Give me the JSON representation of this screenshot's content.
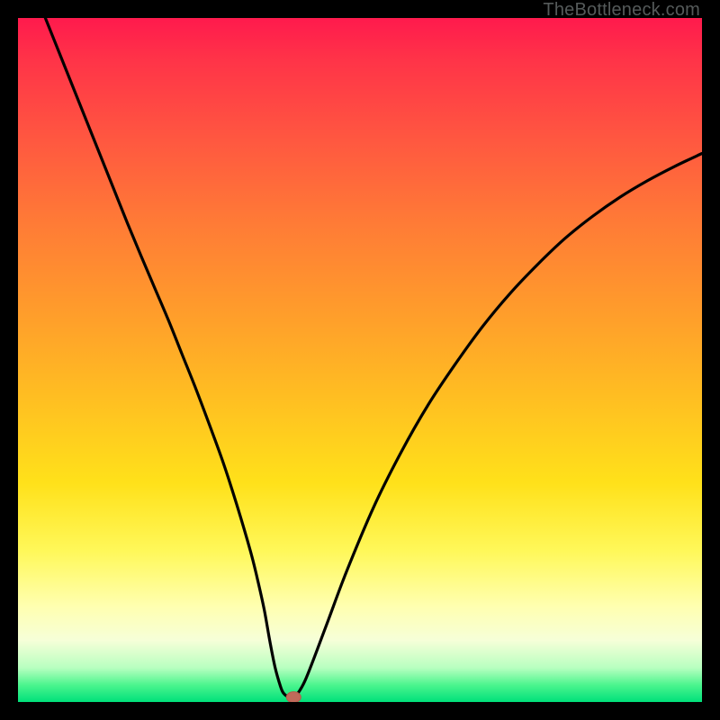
{
  "watermark": "TheBottleneck.com",
  "chart_data": {
    "type": "line",
    "title": "",
    "xlabel": "",
    "ylabel": "",
    "xlim": [
      0,
      100
    ],
    "ylim": [
      0,
      100
    ],
    "grid": false,
    "series": [
      {
        "name": "curve",
        "x": [
          4,
          6,
          8,
          10,
          12,
          14,
          16,
          18,
          20,
          22,
          24,
          26,
          28,
          30,
          32,
          34,
          35,
          36,
          36.8,
          37.6,
          38.4,
          38.8,
          39.4,
          40.2,
          40.4,
          42,
          45,
          48,
          52,
          56,
          60,
          64,
          68,
          72,
          76,
          80,
          84,
          88,
          92,
          96,
          100
        ],
        "y": [
          100,
          95,
          90,
          85,
          80,
          75,
          70,
          65.2,
          60.5,
          55.8,
          50.8,
          45.8,
          40.5,
          35,
          28.8,
          22,
          18,
          13.5,
          9,
          5,
          2.2,
          1.3,
          0.8,
          0.6,
          0.6,
          3.2,
          11,
          19,
          28.5,
          36.5,
          43.5,
          49.5,
          55,
          59.8,
          64,
          67.8,
          71,
          73.8,
          76.2,
          78.3,
          80.2
        ]
      }
    ],
    "marker": {
      "x": 40.3,
      "y": 0.7
    }
  }
}
